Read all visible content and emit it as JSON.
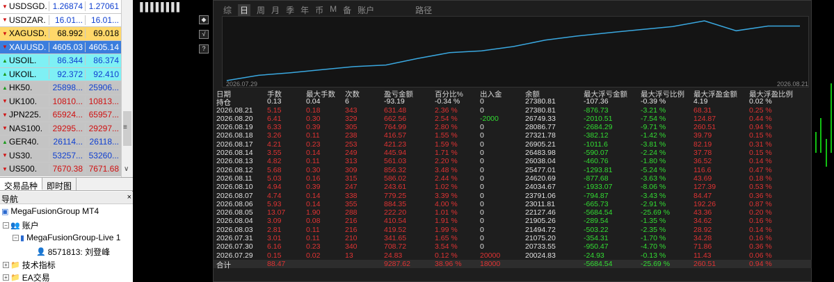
{
  "market_watch": {
    "rows": [
      {
        "symbol": "USDSGD.",
        "bid": "1.26874",
        "ask": "1.27061",
        "dir": "down",
        "bg": "#ffffff",
        "bid_color": "#1040d0",
        "ask_color": "#1040d0"
      },
      {
        "symbol": "USDZAR.",
        "bid": "16.01...",
        "ask": "16.01...",
        "dir": "down",
        "bg": "#ffffff",
        "bid_color": "#1040d0",
        "ask_color": "#1040d0"
      },
      {
        "symbol": "XAGUSD.",
        "bid": "68.992",
        "ask": "69.018",
        "dir": "down",
        "bg": "#ffd86a",
        "bid_color": "#000000",
        "ask_color": "#000000"
      },
      {
        "symbol": "XAUUSD.",
        "bid": "4605.03",
        "ask": "4605.14",
        "dir": "down",
        "bg": "#3b7ddd",
        "bid_color": "#ffffff",
        "ask_color": "#ffffff",
        "selected": true
      },
      {
        "symbol": "USOIL.",
        "bid": "86.344",
        "ask": "86.374",
        "dir": "up",
        "bg": "#7ff0f4",
        "bid_color": "#1040d0",
        "ask_color": "#1040d0"
      },
      {
        "symbol": "UKOIL.",
        "bid": "92.372",
        "ask": "92.410",
        "dir": "up",
        "bg": "#7ff0f4",
        "bid_color": "#1040d0",
        "ask_color": "#1040d0"
      },
      {
        "symbol": "HK50.",
        "bid": "25898...",
        "ask": "25906...",
        "dir": "up",
        "bg": "#c4c4c4",
        "bid_color": "#1040d0",
        "ask_color": "#1040d0"
      },
      {
        "symbol": "UK100.",
        "bid": "10810...",
        "ask": "10813...",
        "dir": "down",
        "bg": "#c4c4c4",
        "bid_color": "#d01010",
        "ask_color": "#d01010"
      },
      {
        "symbol": "JPN225.",
        "bid": "65924...",
        "ask": "65957...",
        "dir": "down",
        "bg": "#c4c4c4",
        "bid_color": "#d01010",
        "ask_color": "#d01010"
      },
      {
        "symbol": "NAS100.",
        "bid": "29295...",
        "ask": "29297...",
        "dir": "down",
        "bg": "#c4c4c4",
        "bid_color": "#d01010",
        "ask_color": "#d01010"
      },
      {
        "symbol": "GER40.",
        "bid": "26114...",
        "ask": "26118...",
        "dir": "up",
        "bg": "#c4c4c4",
        "bid_color": "#1040d0",
        "ask_color": "#1040d0"
      },
      {
        "symbol": "US30.",
        "bid": "53257...",
        "ask": "53260...",
        "dir": "down",
        "bg": "#c4c4c4",
        "bid_color": "#1040d0",
        "ask_color": "#1040d0"
      },
      {
        "symbol": "US500.",
        "bid": "7670.38",
        "ask": "7671.68",
        "dir": "down",
        "bg": "#c4c4c4",
        "bid_color": "#d01010",
        "ask_color": "#d01010"
      }
    ]
  },
  "tabs": {
    "symbols": "交易品种",
    "tick": "即时图"
  },
  "navigator": {
    "title": "导航",
    "root": "MegaFusionGroup MT4",
    "accounts": "账户",
    "server": "MegaFusionGroup-Live 1",
    "account": "8571813: 刘登峰",
    "indicators": "技术指标",
    "ea": "EA交易"
  },
  "toolbar": {
    "glyphs": "▐▐▐▐▐▐▐▐"
  },
  "vtools": [
    "◆",
    "√",
    "?"
  ],
  "panel": {
    "tabs": [
      "综",
      "日",
      "周",
      "月",
      "季",
      "年",
      "币",
      "M",
      "备",
      "账户",
      "路径"
    ],
    "active_tab": "日",
    "date_start": "2026.07.29",
    "date_end": "2026.08.21",
    "equity": [
      20024,
      20733,
      21075,
      21495,
      21906,
      22127,
      23011,
      23791,
      24035,
      24621,
      25477,
      26038,
      26484,
      26905,
      27322,
      28087,
      26749,
      27381,
      27381
    ],
    "headers": [
      "日期",
      "手数",
      "最大手数",
      "次数",
      "盈亏金额",
      "百分比%",
      "出入金",
      "余额",
      "最大浮亏金额",
      "最大浮亏比例",
      "最大浮盈金额",
      "最大浮盈比例"
    ],
    "hold": [
      "持仓",
      "0.13",
      "0.04",
      "6",
      "-93.19",
      "-0.34 %",
      "0",
      "27380.81",
      "-107.36",
      "-0.39 %",
      "4.19",
      "0.02 %"
    ],
    "rows": [
      [
        "2026.08.21",
        "5.15",
        "0.18",
        "343",
        "631.48",
        "2.36 %",
        "0",
        "27380.81",
        "-876.73",
        "-3.21 %",
        "68.31",
        "0.25 %"
      ],
      [
        "2026.08.20",
        "6.41",
        "0.30",
        "329",
        "662.56",
        "2.54 %",
        "-2000",
        "26749.33",
        "-2010.51",
        "-7.54 %",
        "124.87",
        "0.44 %"
      ],
      [
        "2026.08.19",
        "6.33",
        "0.39",
        "305",
        "764.99",
        "2.80 %",
        "0",
        "28086.77",
        "-2684.29",
        "-9.71 %",
        "260.51",
        "0.94 %"
      ],
      [
        "2026.08.18",
        "3.26",
        "0.11",
        "238",
        "416.57",
        "1.55 %",
        "0",
        "27321.78",
        "-382.12",
        "-1.42 %",
        "39.79",
        "0.15 %"
      ],
      [
        "2026.08.17",
        "4.21",
        "0.23",
        "253",
        "421.23",
        "1.59 %",
        "0",
        "26905.21",
        "-1011.6",
        "-3.81 %",
        "82.19",
        "0.31 %"
      ],
      [
        "2026.08.14",
        "3.55",
        "0.14",
        "249",
        "445.94",
        "1.71 %",
        "0",
        "26483.98",
        "-590.07",
        "-2.24 %",
        "37.78",
        "0.15 %"
      ],
      [
        "2026.08.13",
        "4.82",
        "0.11",
        "313",
        "561.03",
        "2.20 %",
        "0",
        "26038.04",
        "-460.76",
        "-1.80 %",
        "36.52",
        "0.14 %"
      ],
      [
        "2026.08.12",
        "5.68",
        "0.30",
        "309",
        "856.32",
        "3.48 %",
        "0",
        "25477.01",
        "-1293.81",
        "-5.24 %",
        "116.6",
        "0.47 %"
      ],
      [
        "2026.08.11",
        "5.03",
        "0.16",
        "315",
        "586.02",
        "2.44 %",
        "0",
        "24620.69",
        "-877.68",
        "-3.63 %",
        "43.69",
        "0.18 %"
      ],
      [
        "2026.08.10",
        "4.94",
        "0.39",
        "247",
        "243.61",
        "1.02 %",
        "0",
        "24034.67",
        "-1933.07",
        "-8.06 %",
        "127.39",
        "0.53 %"
      ],
      [
        "2026.08.07",
        "4.74",
        "0.14",
        "338",
        "779.25",
        "3.39 %",
        "0",
        "23791.06",
        "-794.87",
        "-3.43 %",
        "84.47",
        "0.36 %"
      ],
      [
        "2026.08.06",
        "5.93",
        "0.14",
        "355",
        "884.35",
        "4.00 %",
        "0",
        "23011.81",
        "-665.73",
        "-2.91 %",
        "192.26",
        "0.87 %"
      ],
      [
        "2026.08.05",
        "13.07",
        "1.90",
        "288",
        "222.20",
        "1.01 %",
        "0",
        "22127.46",
        "-5684.54",
        "-25.69 %",
        "43.36",
        "0.20 %"
      ],
      [
        "2026.08.04",
        "3.09",
        "0.08",
        "216",
        "410.54",
        "1.91 %",
        "0",
        "21905.26",
        "-289.54",
        "-1.35 %",
        "34.62",
        "0.16 %"
      ],
      [
        "2026.08.03",
        "2.81",
        "0.11",
        "216",
        "419.52",
        "1.99 %",
        "0",
        "21494.72",
        "-503.22",
        "-2.35 %",
        "28.92",
        "0.14 %"
      ],
      [
        "2026.07.31",
        "3.01",
        "0.11",
        "210",
        "341.65",
        "1.65 %",
        "0",
        "21075.20",
        "-354.31",
        "-1.70 %",
        "34.28",
        "0.16 %"
      ],
      [
        "2026.07.30",
        "6.16",
        "0.23",
        "340",
        "708.72",
        "3.54 %",
        "0",
        "20733.55",
        "-950.47",
        "-4.70 %",
        "71.86",
        "0.36 %"
      ],
      [
        "2026.07.29",
        "0.15",
        "0.02",
        "13",
        "24.83",
        "0.12 %",
        "20000",
        "20024.83",
        "-24.93",
        "-0.13 %",
        "11.43",
        "0.06 %"
      ]
    ],
    "total": [
      "合计",
      "88.47",
      "",
      "",
      "9287.62",
      "38.96 %",
      "18000",
      "",
      "-5684.54",
      "-25.69 %",
      "260.51",
      "0.94 %"
    ]
  }
}
